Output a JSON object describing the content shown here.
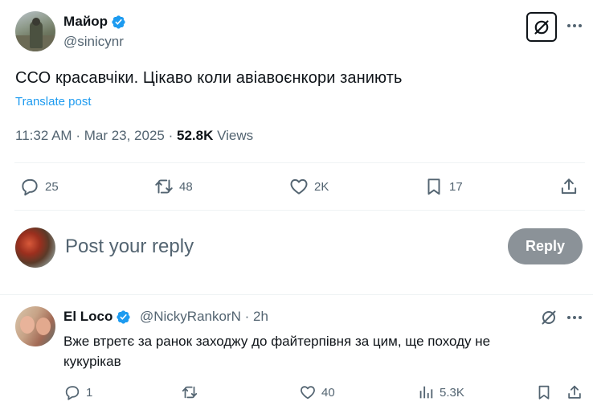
{
  "post": {
    "author_name": "Майор",
    "author_handle": "@sinicynr",
    "text": "ССО красавчіки. Цікаво коли авіавоєнкори заниють",
    "translate_label": "Translate post",
    "time": "11:32 AM",
    "date": "Mar 23, 2025",
    "views_count": "52.8K",
    "views_label": "Views",
    "stats": {
      "replies": "25",
      "reposts": "48",
      "likes": "2K",
      "bookmarks": "17"
    }
  },
  "composer": {
    "placeholder": "Post your reply",
    "button_label": "Reply"
  },
  "reply": {
    "author_name": "El Loco",
    "author_handle": "@NickyRankorN",
    "age": "2h",
    "text": "Вже втретє за ранок заходжу до файтерпівня за цим, ще походу не кукурікав",
    "stats": {
      "replies": "1",
      "reposts": "",
      "likes": "40",
      "views": "5.3K"
    }
  },
  "colors": {
    "accent": "#1d9bf0",
    "verified": "#1d9bf0",
    "text_secondary": "#536471",
    "reply_button_bg": "#8b9298"
  },
  "icons": {
    "verified": "verified-badge-icon",
    "grok": "grok-icon",
    "more": "more-dots-icon",
    "reply": "reply-bubble-icon",
    "repost": "repost-icon",
    "like": "heart-icon",
    "bookmark": "bookmark-icon",
    "share": "share-icon",
    "views": "views-chart-icon"
  }
}
